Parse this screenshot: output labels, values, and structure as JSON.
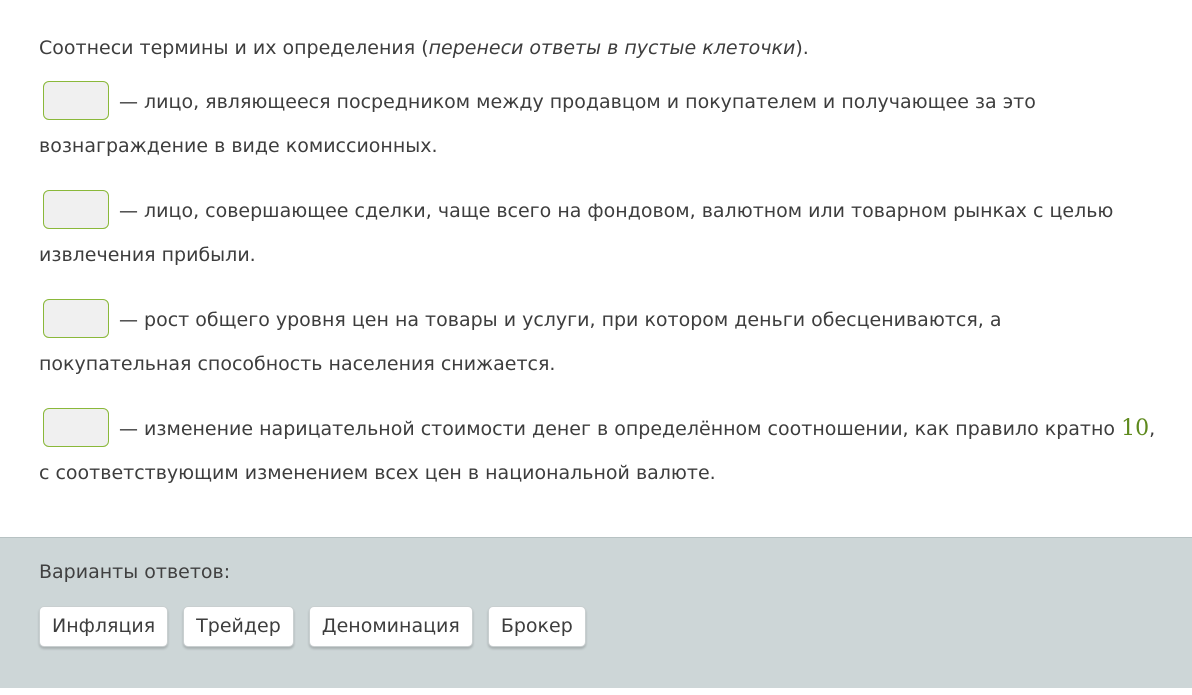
{
  "task": {
    "instruction_main": "Соотнеси термины и их определения (",
    "instruction_italic": "перенеси ответы в пустые клеточки",
    "instruction_end": ")."
  },
  "items": [
    {
      "text_before": "— лицо, являющееся посредником между продавцом и покупателем и получающее за это вознаграждение в виде комиссионных."
    },
    {
      "text_before": "— лицо, совершающее сделки, чаще всего на фондовом, валютном или товарном рынках с целью извлечения прибыли."
    },
    {
      "text_before": "— рост общего уровня цен на товары и услуги, при котором деньги обесцениваются, а покупательная способность населения снижается."
    },
    {
      "text_before": "— изменение нарицательной стоимости денег в определённом соотношении, как правило кратно ",
      "number": "10",
      "text_after": ", с соответствующим изменением всех цен в национальной валюте."
    }
  ],
  "answers": {
    "title": "Варианты ответов:",
    "options": [
      "Инфляция",
      "Трейдер",
      "Деноминация",
      "Брокер"
    ]
  }
}
